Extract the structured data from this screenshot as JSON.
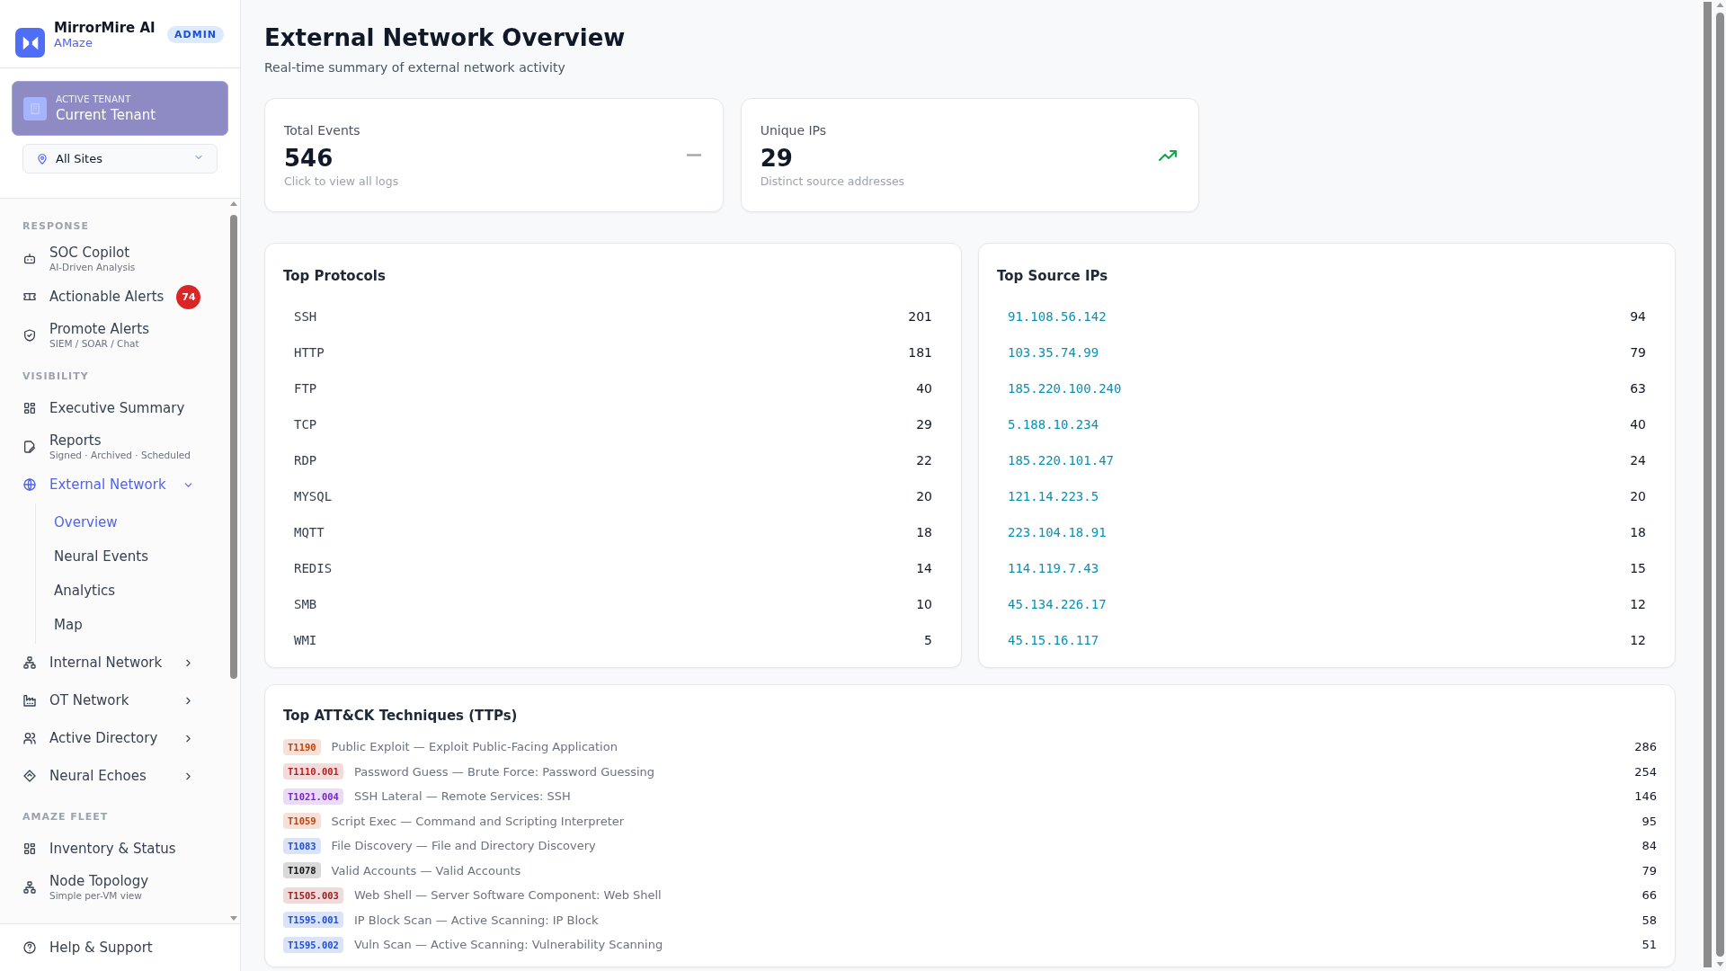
{
  "sidebar": {
    "brand": {
      "name": "MirrorMire AI",
      "subtitle": "AMaze",
      "role": "ADMIN"
    },
    "tenant": {
      "label": "ACTIVE TENANT",
      "name": "Current Tenant",
      "disabled": true
    },
    "site_select": {
      "value": "All Sites"
    },
    "sections": [
      {
        "title": "RESPONSE",
        "items": [
          {
            "label": "SOC Copilot",
            "subtitle": "AI-Driven Analysis",
            "selected": false
          },
          {
            "label": "Actionable Alerts",
            "badge": "74",
            "selected": false
          },
          {
            "label": "Promote Alerts",
            "subtitle": "SIEM / SOAR / Chat",
            "selected": false
          }
        ]
      },
      {
        "title": "VISIBILITY",
        "items": [
          {
            "label": "Executive Summary",
            "selected": false
          },
          {
            "label": "Reports",
            "subtitle": "Signed · Archived · Scheduled",
            "selected": false
          },
          {
            "label": "External Network",
            "selected": true,
            "expanded": true,
            "children": [
              {
                "label": "Overview",
                "selected": true
              },
              {
                "label": "Neural Events",
                "selected": false
              },
              {
                "label": "Analytics",
                "selected": false
              },
              {
                "label": "Map",
                "selected": false
              }
            ]
          },
          {
            "label": "Internal Network",
            "selected": false,
            "expanded": false
          },
          {
            "label": "OT Network",
            "selected": false,
            "expanded": false
          },
          {
            "label": "Active Directory",
            "selected": false,
            "expanded": false
          },
          {
            "label": "Neural Echoes",
            "selected": false,
            "expanded": false
          }
        ]
      },
      {
        "title": "AMAZE FLEET",
        "items": [
          {
            "label": "Inventory & Status",
            "selected": false
          },
          {
            "label": "Node Topology",
            "subtitle": "Simple per-VM view",
            "selected": false
          }
        ]
      }
    ],
    "footer": {
      "label": "Help & Support"
    }
  },
  "page": {
    "title": "External Network Overview",
    "subtitle": "Real-time summary of external network activity"
  },
  "stats": [
    {
      "label": "Total Events",
      "value": "546",
      "caption": "Click to view all logs",
      "kind": "flat"
    },
    {
      "label": "Unique IPs",
      "value": "29",
      "caption": "Distinct source addresses",
      "kind": "up"
    }
  ],
  "top_protocols": {
    "title": "Top Protocols",
    "rows": [
      {
        "name": "SSH",
        "count": "201"
      },
      {
        "name": "HTTP",
        "count": "181"
      },
      {
        "name": "FTP",
        "count": "40"
      },
      {
        "name": "TCP",
        "count": "29"
      },
      {
        "name": "RDP",
        "count": "22"
      },
      {
        "name": "MYSQL",
        "count": "20"
      },
      {
        "name": "MQTT",
        "count": "18"
      },
      {
        "name": "REDIS",
        "count": "14"
      },
      {
        "name": "SMB",
        "count": "10"
      },
      {
        "name": "WMI",
        "count": "5"
      }
    ]
  },
  "top_source_ips": {
    "title": "Top Source IPs",
    "rows": [
      {
        "name": "91.108.56.142",
        "count": "94"
      },
      {
        "name": "103.35.74.99",
        "count": "79"
      },
      {
        "name": "185.220.100.240",
        "count": "63"
      },
      {
        "name": "5.188.10.234",
        "count": "40"
      },
      {
        "name": "185.220.101.47",
        "count": "24"
      },
      {
        "name": "121.14.223.5",
        "count": "20"
      },
      {
        "name": "223.104.18.91",
        "count": "18"
      },
      {
        "name": "114.119.7.43",
        "count": "15"
      },
      {
        "name": "45.134.226.17",
        "count": "12"
      },
      {
        "name": "45.15.16.117",
        "count": "12"
      }
    ]
  },
  "ttps": {
    "title": "Top ATT&CK Techniques (TTPs)",
    "rows": [
      {
        "id": "T1190",
        "color": "#c2410c",
        "label": "Public Exploit — Exploit Public-Facing Application",
        "count": "286"
      },
      {
        "id": "T1110.001",
        "color": "#b91c1c",
        "label": "Password Guess — Brute Force: Password Guessing",
        "count": "254"
      },
      {
        "id": "T1021.004",
        "color": "#7e22ce",
        "label": "SSH Lateral — Remote Services: SSH",
        "count": "146"
      },
      {
        "id": "T1059",
        "color": "#c2410c",
        "label": "Script Exec — Command and Scripting Interpreter",
        "count": "95"
      },
      {
        "id": "T1083",
        "color": "#1d4ed8",
        "label": "File Discovery — File and Directory Discovery",
        "count": "84"
      },
      {
        "id": "T1078",
        "color": "#111111",
        "label": "Valid Accounts — Valid Accounts",
        "count": "79"
      },
      {
        "id": "T1505.003",
        "color": "#991b1b",
        "label": "Web Shell — Server Software Component: Web Shell",
        "count": "66"
      },
      {
        "id": "T1595.001",
        "color": "#1d4ed8",
        "label": "IP Block Scan — Active Scanning: IP Block",
        "count": "58"
      },
      {
        "id": "T1595.002",
        "color": "#1d4ed8",
        "label": "Vuln Scan — Active Scanning: Vulnerability Scanning",
        "count": "51"
      }
    ]
  }
}
